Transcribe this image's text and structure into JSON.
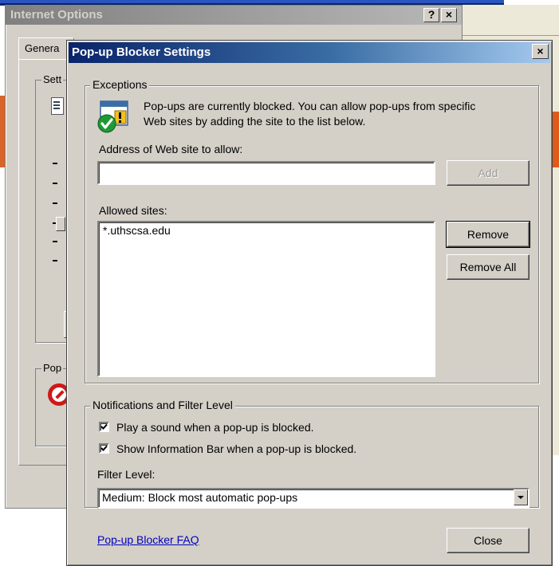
{
  "background_window": {
    "title": "Internet Options",
    "help_btn": "?",
    "close_btn": "×",
    "tab_general": "Genera",
    "group_settings": "Sett",
    "group_popup": "Pop"
  },
  "dialog": {
    "title": "Pop-up Blocker Settings",
    "close_btn": "×",
    "exceptions": {
      "legend": "Exceptions",
      "info_line1": "Pop-ups are currently blocked.  You can allow pop-ups from specific",
      "info_line2": "Web sites by adding the site to the list below.",
      "address_label": "Address of Web site to allow:",
      "address_value": "",
      "add_button": "Add",
      "allowed_label": "Allowed sites:",
      "allowed_sites": [
        "*.uthscsa.edu"
      ],
      "remove_button": "Remove",
      "remove_all_button": "Remove All"
    },
    "notifications": {
      "legend": "Notifications and Filter Level",
      "play_sound_label": "Play a sound when a pop-up is blocked.",
      "play_sound_checked": true,
      "info_bar_label": "Show Information Bar when a pop-up is blocked.",
      "info_bar_checked": true,
      "filter_level_label": "Filter Level:",
      "filter_level_value": "Medium: Block most automatic pop-ups"
    },
    "faq_link": "Pop-up Blocker FAQ",
    "close_button": "Close"
  },
  "colors": {
    "dialog_face": "#d4d0c8",
    "title_active_start": "#0a246a",
    "title_active_end": "#a6caf0",
    "link": "#0000c0"
  }
}
